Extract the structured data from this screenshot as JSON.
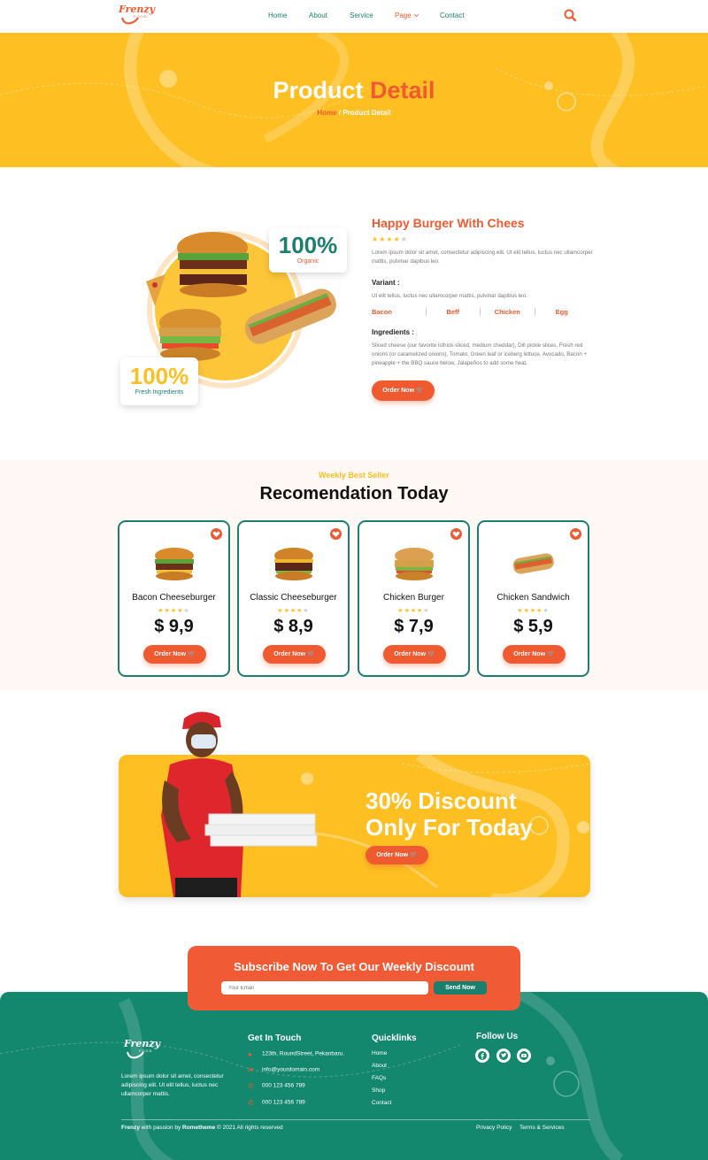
{
  "brand": {
    "name": "Frenzy",
    "tagline": "FOOD"
  },
  "nav": {
    "items": [
      {
        "label": "Home"
      },
      {
        "label": "About"
      },
      {
        "label": "Service"
      },
      {
        "label": "Page"
      },
      {
        "label": "Contact"
      }
    ],
    "active_index": 3,
    "search_icon": "search-icon"
  },
  "hero": {
    "title_main": "Product",
    "title_accent": "Detail",
    "breadcrumb_home": "Home",
    "breadcrumb_sep": " / ",
    "breadcrumb_current": "Product Detail"
  },
  "product": {
    "title": "Happy Burger With Chees",
    "rating": 4,
    "rating_max": 5,
    "description": "Lorem ipsum dolor sit amet, consectetur adipiscing elit. Ut elit tellus, luctus nec ullamcorper mattis, pulvinar dapibus leo.",
    "variant_heading": "Variant :",
    "variant_desc": "Ut elit tellus, luctus nec ullamcorper mattis, pulvinar dapibus leo.",
    "variants": [
      "Bacon",
      "Beff",
      "Chicken",
      "Egg"
    ],
    "ingredients_heading": "Ingredients :",
    "ingredients_text": "Sliced cheese (our favorite isthick-sliced, medium cheddar), Dill pickle slices, Fresh red onions (or caramelized onions), Tomato, Green leaf or iceberg lettuce, Avocado, Bacon + pineapple + the BBQ sauce below, Jalapeños to add some heat.",
    "order_label": "Order Now",
    "badge_organic": {
      "value": "100%",
      "caption": "Organic"
    },
    "badge_fresh": {
      "value": "100%",
      "caption": "Fresh Ingredients"
    }
  },
  "recommendation": {
    "kicker": "Weekly Best Seller",
    "title": "Recomendation Today",
    "items": [
      {
        "name": "Bacon Cheeseburger",
        "price": "$ 9,9",
        "rating": 4,
        "order_label": "Order Now"
      },
      {
        "name": "Classic Cheeseburger",
        "price": "$ 8,9",
        "rating": 4,
        "order_label": "Order Now"
      },
      {
        "name": "Chicken Burger",
        "price": "$ 7,9",
        "rating": 4,
        "order_label": "Order Now"
      },
      {
        "name": "Chicken Sandwich",
        "price": "$ 5,9",
        "rating": 4,
        "order_label": "Order Now"
      }
    ]
  },
  "promo": {
    "line1": "30% Discount",
    "line2": "Only For Today",
    "order_label": "Order Now"
  },
  "subscribe": {
    "title": "Subscribe Now To Get Our Weekly Discount",
    "placeholder": "Your Email",
    "button": "Send Now"
  },
  "footer": {
    "about": "Lorem ipsum dolor sit amet, consectetur adipiscing elit. Ut elit tellus, luctus nec ullamcorper mattis.",
    "contact_heading": "Get In Touch",
    "contacts": [
      {
        "icon": "map-pin-icon",
        "text": "123th, RoundStreet, Pekanbaru."
      },
      {
        "icon": "mail-icon",
        "text": "info@yourdomain.com"
      },
      {
        "icon": "phone-icon",
        "text": "000 123 456 789"
      },
      {
        "icon": "phone-icon",
        "text": "000 123 456 789"
      }
    ],
    "quicklinks_heading": "Quicklinks",
    "quicklinks": [
      "Home",
      "About",
      "FAQs",
      "Shop",
      "Contact"
    ],
    "follow_heading": "Follow Us",
    "socials": [
      "facebook-icon",
      "twitter-icon",
      "youtube-icon"
    ],
    "copyright_brand": "Frenzy",
    "copyright_mid": " with passion by ",
    "copyright_author": "Rometheme",
    "copyright_tail": " © 2021 All rights reserved",
    "privacy": "Privacy Policy",
    "terms": "Terms & Services"
  },
  "colors": {
    "primary_yellow": "#fdbf22",
    "accent_orange": "#ef5a30",
    "teal": "#1b7f6e",
    "footer_teal": "#14876f"
  }
}
